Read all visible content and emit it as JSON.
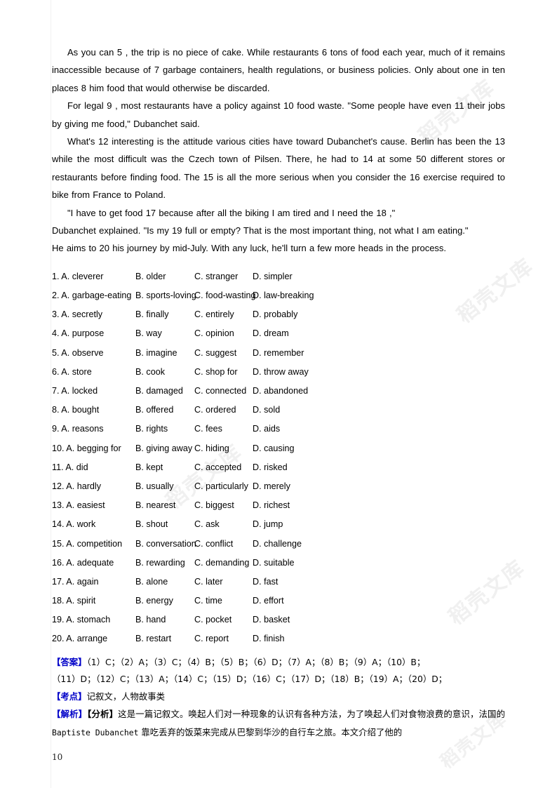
{
  "document": {
    "page_number": "10",
    "watermark_text": "稻壳文库"
  },
  "passage": {
    "paragraphs": [
      "As you can 5 , the trip is no piece of cake. While restaurants 6 tons of food each year, much of it remains inaccessible because of 7 garbage containers, health regulations, or business policies. Only about one in ten places 8 him food that would otherwise be discarded.",
      "For legal 9 , most restaurants have a policy against 10 food waste. \"Some people have even 11 their jobs by giving me food,\" Dubanchet said.",
      "What's 12 interesting is the attitude various cities have toward Dubanchet's cause. Berlin has been the 13 while the most difficult was the Czech town of Pilsen. There, he had to 14 at some 50 different stores or restaurants before finding food. The 15 is all the more serious when you consider the 16 exercise required to bike from France to Poland.",
      "\"I have to get food 17 because after all the biking I am tired and I need the 18 ,\"",
      "Dubanchet explained. \"Is my 19 full or empty? That is the most important thing, not what I am eating.\"",
      "He aims to 20 his journey by mid-July. With any luck, he'll turn a few more heads in the process."
    ]
  },
  "questions": [
    {
      "number": "1.",
      "a": "A. cleverer",
      "b": "B. older",
      "c": "C. stranger",
      "d": "D. simpler"
    },
    {
      "number": "2.",
      "a": "A. garbage-eating",
      "b": "B. sports-loving",
      "c": "C. food-wasting",
      "d": "D. law-breaking"
    },
    {
      "number": "3.",
      "a": "A. secretly",
      "b": "B. finally",
      "c": "C. entirely",
      "d": "D. probably"
    },
    {
      "number": "4.",
      "a": "A. purpose",
      "b": "B. way",
      "c": "C. opinion",
      "d": "D. dream"
    },
    {
      "number": "5.",
      "a": "A. observe",
      "b": "B. imagine",
      "c": "C. suggest",
      "d": "D. remember"
    },
    {
      "number": "6.",
      "a": "A. store",
      "b": "B. cook",
      "c": "C. shop for",
      "d": "D. throw away"
    },
    {
      "number": "7.",
      "a": "A. locked",
      "b": "B. damaged",
      "c": "C. connected",
      "d": "D. abandoned"
    },
    {
      "number": "8.",
      "a": "A. bought",
      "b": "B. offered",
      "c": "C. ordered",
      "d": "D. sold"
    },
    {
      "number": "9.",
      "a": "A. reasons",
      "b": "B. rights",
      "c": "C. fees",
      "d": "D. aids"
    },
    {
      "number": "10.",
      "a": "A. begging for",
      "b": "B. giving away",
      "c": "C. hiding",
      "d": "D. causing"
    },
    {
      "number": "11.",
      "a": "A. did",
      "b": "B. kept",
      "c": "C. accepted",
      "d": "D. risked"
    },
    {
      "number": "12.",
      "a": "A. hardly",
      "b": "B. usually",
      "c": "C. particularly",
      "d": "D. merely"
    },
    {
      "number": "13.",
      "a": "A. easiest",
      "b": "B. nearest",
      "c": "C. biggest",
      "d": "D. richest"
    },
    {
      "number": "14.",
      "a": "A. work",
      "b": "B. shout",
      "c": "C. ask",
      "d": "D. jump"
    },
    {
      "number": "15.",
      "a": "A. competition",
      "b": "B. conversation",
      "c": "C. conflict",
      "d": "D. challenge"
    },
    {
      "number": "16.",
      "a": "A. adequate",
      "b": "B. rewarding",
      "c": "C. demanding",
      "d": "D. suitable"
    },
    {
      "number": "17.",
      "a": "A. again",
      "b": "B. alone",
      "c": "C. later",
      "d": "D. fast"
    },
    {
      "number": "18.",
      "a": "A. spirit",
      "b": "B. energy",
      "c": "C. time",
      "d": "D. effort"
    },
    {
      "number": "19.",
      "a": "A. stomach",
      "b": "B. hand",
      "c": "C. pocket",
      "d": "D. basket"
    },
    {
      "number": "20.",
      "a": "A. arrange",
      "b": "B. restart",
      "c": "C. report",
      "d": "D. finish"
    }
  ],
  "answer_section": {
    "answer_tag": "【答案】",
    "answers_line1": "（1）C；（2）A；（3）C；（4）B；（5）B；（6）D；（7）A；（8）B；（9）A；（10）B；",
    "answers_line2": "（11）D；（12）C；（13）A；（14）C；（15）D；（16）C；（17）D；（18）B；（19）A；（20）D；",
    "keypoint_tag": "【考点】",
    "keypoint_text": "记叙文，人物故事类",
    "analysis_tag": "【解析】",
    "analysis_sub_tag": "【分析】",
    "analysis_text_part1": "这是一篇记叙文。唤起人们对一种现象的认识有各种方法，为了唤起人们对食物浪费的意识，法国的 ",
    "analysis_name": "Baptiste Dubanchet",
    "analysis_text_part2": " 靠吃丢弃的饭菜来完成从巴黎到华沙的自行车之旅。本文介绍了他的"
  },
  "colors": {
    "tag_blue": "#0000c8",
    "text_black": "#000000",
    "watermark_gray": "#f0f0f0"
  }
}
